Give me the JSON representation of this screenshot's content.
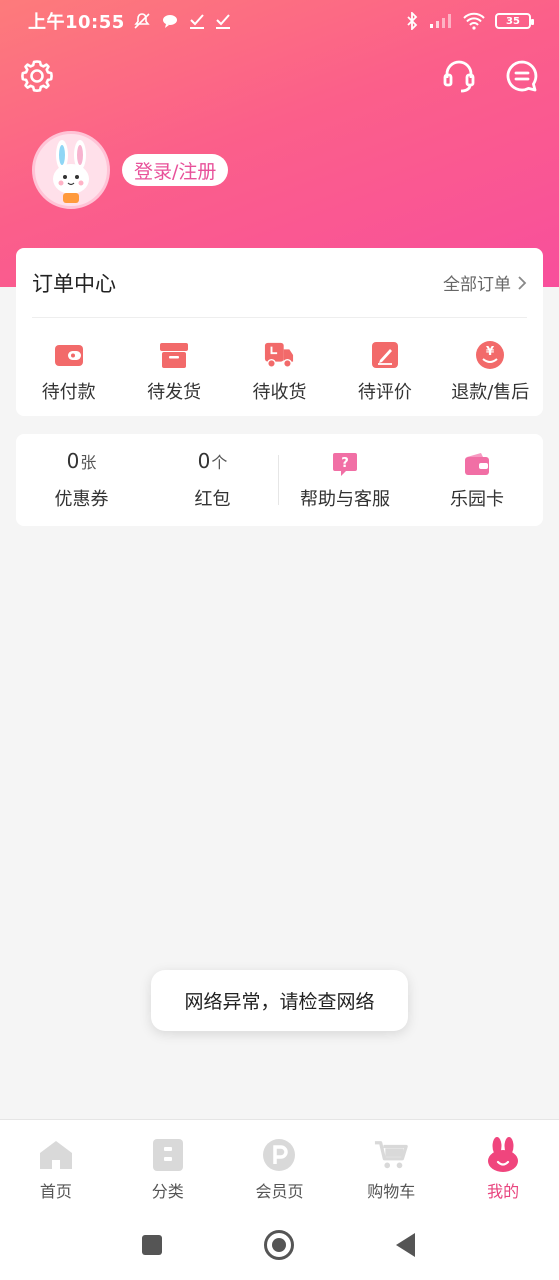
{
  "status_bar": {
    "time": "上午10:55",
    "battery": "35"
  },
  "profile": {
    "login_label": "登录/注册"
  },
  "order_center": {
    "title": "订单中心",
    "all_orders": "全部订单",
    "items": [
      {
        "label": "待付款",
        "icon": "wallet-icon"
      },
      {
        "label": "待发货",
        "icon": "box-icon"
      },
      {
        "label": "待收货",
        "icon": "truck-icon"
      },
      {
        "label": "待评价",
        "icon": "pen-icon"
      },
      {
        "label": "退款/售后",
        "icon": "yuan-icon"
      }
    ]
  },
  "assets": {
    "coupon": {
      "value": "0",
      "unit": "张",
      "label": "优惠券"
    },
    "redpacket": {
      "value": "0",
      "unit": "个",
      "label": "红包"
    },
    "help": {
      "label": "帮助与客服",
      "icon": "question-icon"
    },
    "park_card": {
      "label": "乐园卡",
      "icon": "card-wallet-icon"
    }
  },
  "toast": {
    "message": "网络异常，请检查网络"
  },
  "tabbar": {
    "tabs": [
      {
        "label": "首页",
        "icon": "home-icon"
      },
      {
        "label": "分类",
        "icon": "category-icon"
      },
      {
        "label": "会员页",
        "icon": "member-icon"
      },
      {
        "label": "购物车",
        "icon": "cart-icon"
      },
      {
        "label": "我的",
        "icon": "bunny-icon",
        "active": true
      }
    ]
  },
  "colors": {
    "accent": "#e8447e",
    "header_start": "#fd7b7b",
    "header_end": "#f84f9c",
    "icon_red": "#f26a6a"
  }
}
